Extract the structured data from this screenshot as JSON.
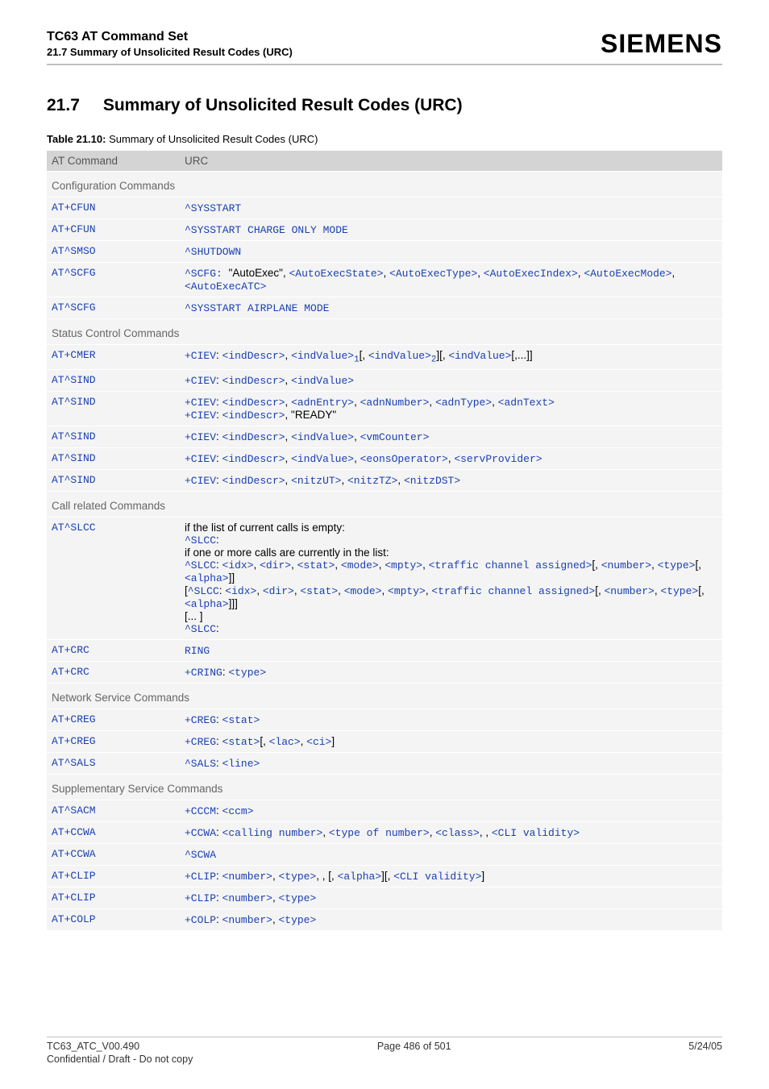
{
  "header": {
    "title": "TC63 AT Command Set",
    "subtitle": "21.7 Summary of Unsolicited Result Codes (URC)",
    "brand": "SIEMENS"
  },
  "section": {
    "number": "21.7",
    "title": "Summary of Unsolicited Result Codes (URC)"
  },
  "table_caption_bold": "Table 21.10:",
  "table_caption_rest": " Summary of Unsolicited Result Codes (URC)",
  "columns": {
    "cmd": "AT Command",
    "urc": "URC"
  },
  "groups": [
    {
      "name": "Configuration Commands",
      "rows": [
        {
          "cmd": "AT+CFUN",
          "urc_html": "<span class='mono'>^SYSSTART</span>"
        },
        {
          "cmd": "AT+CFUN",
          "urc_html": "<span class='mono'>^SYSSTART CHARGE ONLY MODE</span>"
        },
        {
          "cmd": "AT^SMSO",
          "urc_html": "<span class='mono'>^SHUTDOWN</span>"
        },
        {
          "cmd": "AT^SCFG",
          "urc_html": "<span class='mono'>^SCFG: </span><span class='plain'>\"AutoExec\", </span><span class='mono'>&lt;AutoExecState&gt;</span><span class='plain'>, </span><span class='mono'>&lt;AutoExecType&gt;</span><span class='plain'>, </span><span class='mono'>&lt;AutoExecIndex&gt;</span><span class='plain'>, </span><span class='mono'>&lt;AutoExecMode&gt;</span><span class='plain'>, </span><span class='mono'>&lt;AutoExecATC&gt;</span>"
        },
        {
          "cmd": "AT^SCFG",
          "urc_html": "<span class='mono'>^SYSSTART AIRPLANE MODE</span>"
        }
      ]
    },
    {
      "name": "Status Control Commands",
      "rows": [
        {
          "cmd": "AT+CMER",
          "urc_html": "<span class='mono'>+CIEV</span><span class='plain'>: </span><span class='mono'>&lt;indDescr&gt;</span><span class='plain'>, </span><span class='mono'>&lt;indValue&gt;<sub>1</sub></span><span class='plain'>[, </span><span class='mono'>&lt;indValue&gt;<sub>2</sub></span><span class='plain'>][, </span><span class='mono'>&lt;indValue&gt;</span><span class='plain'>[,...]]</span>"
        },
        {
          "cmd": "AT^SIND",
          "urc_html": "<span class='mono'>+CIEV</span><span class='plain'>: </span><span class='mono'>&lt;indDescr&gt;</span><span class='plain'>, </span><span class='mono'>&lt;indValue&gt;</span>"
        },
        {
          "cmd": "AT^SIND",
          "urc_html": "<span class='mono'>+CIEV</span><span class='plain'>: </span><span class='mono'>&lt;indDescr&gt;</span><span class='plain'>, </span><span class='mono'>&lt;adnEntry&gt;</span><span class='plain'>, </span><span class='mono'>&lt;adnNumber&gt;</span><span class='plain'>, </span><span class='mono'>&lt;adnType&gt;</span><span class='plain'>, </span><span class='mono'>&lt;adnText&gt;</span><br><span class='mono'>+CIEV</span><span class='plain'>: </span><span class='mono'>&lt;indDescr&gt;</span><span class='plain'>, \"READY\"</span>"
        },
        {
          "cmd": "AT^SIND",
          "urc_html": "<span class='mono'>+CIEV</span><span class='plain'>: </span><span class='mono'>&lt;indDescr&gt;</span><span class='plain'>, </span><span class='mono'>&lt;indValue&gt;</span><span class='plain'>, </span><span class='mono'>&lt;vmCounter&gt;</span>"
        },
        {
          "cmd": "AT^SIND",
          "urc_html": "<span class='mono'>+CIEV</span><span class='plain'>: </span><span class='mono'>&lt;indDescr&gt;</span><span class='plain'>, </span><span class='mono'>&lt;indValue&gt;</span><span class='plain'>, </span><span class='mono'>&lt;eonsOperator&gt;</span><span class='plain'>, </span><span class='mono'>&lt;servProvider&gt;</span>"
        },
        {
          "cmd": "AT^SIND",
          "urc_html": "<span class='mono'>+CIEV</span><span class='plain'>: </span><span class='mono'>&lt;indDescr&gt;</span><span class='plain'>, </span><span class='mono'>&lt;nitzUT&gt;</span><span class='plain'>, </span><span class='mono'>&lt;nitzTZ&gt;</span><span class='plain'>, </span><span class='mono'>&lt;nitzDST&gt;</span>"
        }
      ]
    },
    {
      "name": "Call related Commands",
      "rows": [
        {
          "cmd": "AT^SLCC",
          "urc_html": "<span class='plain'>if the list of current calls is empty:</span><br><span class='mono'>^SLCC</span><span class='plain'>: </span><br><span class='plain'>if one or more calls are currently in the list:</span><br><span class='mono'>^SLCC</span><span class='plain'>: </span><span class='mono'>&lt;idx&gt;</span><span class='plain'>, </span><span class='mono'>&lt;dir&gt;</span><span class='plain'>, </span><span class='mono'>&lt;stat&gt;</span><span class='plain'>, </span><span class='mono'>&lt;mode&gt;</span><span class='plain'>, </span><span class='mono'>&lt;mpty&gt;</span><span class='plain'>, </span><span class='mono'>&lt;traffic channel assigned&gt;</span><span class='plain'>[, </span><span class='mono'>&lt;number&gt;</span><span class='plain'>, </span><span class='mono'>&lt;type&gt;</span><span class='plain'>[, </span><span class='mono'>&lt;alpha&gt;</span><span class='plain'>]]</span><br><span class='plain'>[</span><span class='mono'>^SLCC</span><span class='plain'>: </span><span class='mono'>&lt;idx&gt;</span><span class='plain'>, </span><span class='mono'>&lt;dir&gt;</span><span class='plain'>, </span><span class='mono'>&lt;stat&gt;</span><span class='plain'>, </span><span class='mono'>&lt;mode&gt;</span><span class='plain'>, </span><span class='mono'>&lt;mpty&gt;</span><span class='plain'>, </span><span class='mono'>&lt;traffic channel assigned&gt;</span><span class='plain'>[, </span><span class='mono'>&lt;number&gt;</span><span class='plain'>, </span><span class='mono'>&lt;type&gt;</span><span class='plain'>[, </span><span class='mono'>&lt;alpha&gt;</span><span class='plain'>]]]</span><br><span class='plain'>[... ]</span><br><span class='mono'>^SLCC</span><span class='plain'>: </span>"
        },
        {
          "cmd": "AT+CRC",
          "urc_html": "<span class='mono'>RING</span>"
        },
        {
          "cmd": "AT+CRC",
          "urc_html": "<span class='mono'>+CRING</span><span class='plain'>: </span><span class='mono'>&lt;type&gt;</span>"
        }
      ]
    },
    {
      "name": "Network Service Commands",
      "rows": [
        {
          "cmd": "AT+CREG",
          "urc_html": "<span class='mono'>+CREG</span><span class='plain'>: </span><span class='mono'>&lt;stat&gt;</span>"
        },
        {
          "cmd": "AT+CREG",
          "urc_html": "<span class='mono'>+CREG</span><span class='plain'>: </span><span class='mono'>&lt;stat&gt;</span><span class='plain'>[, </span><span class='mono'>&lt;lac&gt;</span><span class='plain'>, </span><span class='mono'>&lt;ci&gt;</span><span class='plain'>]</span>"
        },
        {
          "cmd": "AT^SALS",
          "urc_html": "<span class='mono'>^SALS</span><span class='plain'>: </span><span class='mono'>&lt;line&gt;</span>"
        }
      ]
    },
    {
      "name": "Supplementary Service Commands",
      "rows": [
        {
          "cmd": "AT^SACM",
          "urc_html": "<span class='mono'>+CCCM</span><span class='plain'>: </span><span class='mono'>&lt;ccm&gt;</span>"
        },
        {
          "cmd": "AT+CCWA",
          "urc_html": "<span class='mono'>+CCWA</span><span class='plain'>: </span><span class='mono'>&lt;calling number&gt;</span><span class='plain'>, </span><span class='mono'>&lt;type of number&gt;</span><span class='plain'>, </span><span class='mono'>&lt;class&gt;</span><span class='plain'>, , </span><span class='mono'>&lt;CLI validity&gt;</span>"
        },
        {
          "cmd": "AT+CCWA",
          "urc_html": "<span class='mono'>^SCWA</span>"
        },
        {
          "cmd": "AT+CLIP",
          "urc_html": "<span class='mono'>+CLIP</span><span class='plain'>: </span><span class='mono'>&lt;number&gt;</span><span class='plain'>, </span><span class='mono'>&lt;type&gt;</span><span class='plain'>, , [, </span><span class='mono'>&lt;alpha&gt;</span><span class='plain'>][, </span><span class='mono'>&lt;CLI validity&gt;</span><span class='plain'>]</span>"
        },
        {
          "cmd": "AT+CLIP",
          "urc_html": "<span class='mono'>+CLIP</span><span class='plain'>: </span><span class='mono'>&lt;number&gt;</span><span class='plain'>, </span><span class='mono'>&lt;type&gt;</span>"
        },
        {
          "cmd": "AT+COLP",
          "urc_html": "<span class='mono'>+COLP</span><span class='plain'>: </span><span class='mono'>&lt;number&gt;</span><span class='plain'>, </span><span class='mono'>&lt;type&gt;</span>"
        }
      ]
    }
  ],
  "footer": {
    "left": "TC63_ATC_V00.490",
    "center": "Page 486 of 501",
    "right": "5/24/05",
    "conf": "Confidential / Draft - Do not copy"
  }
}
